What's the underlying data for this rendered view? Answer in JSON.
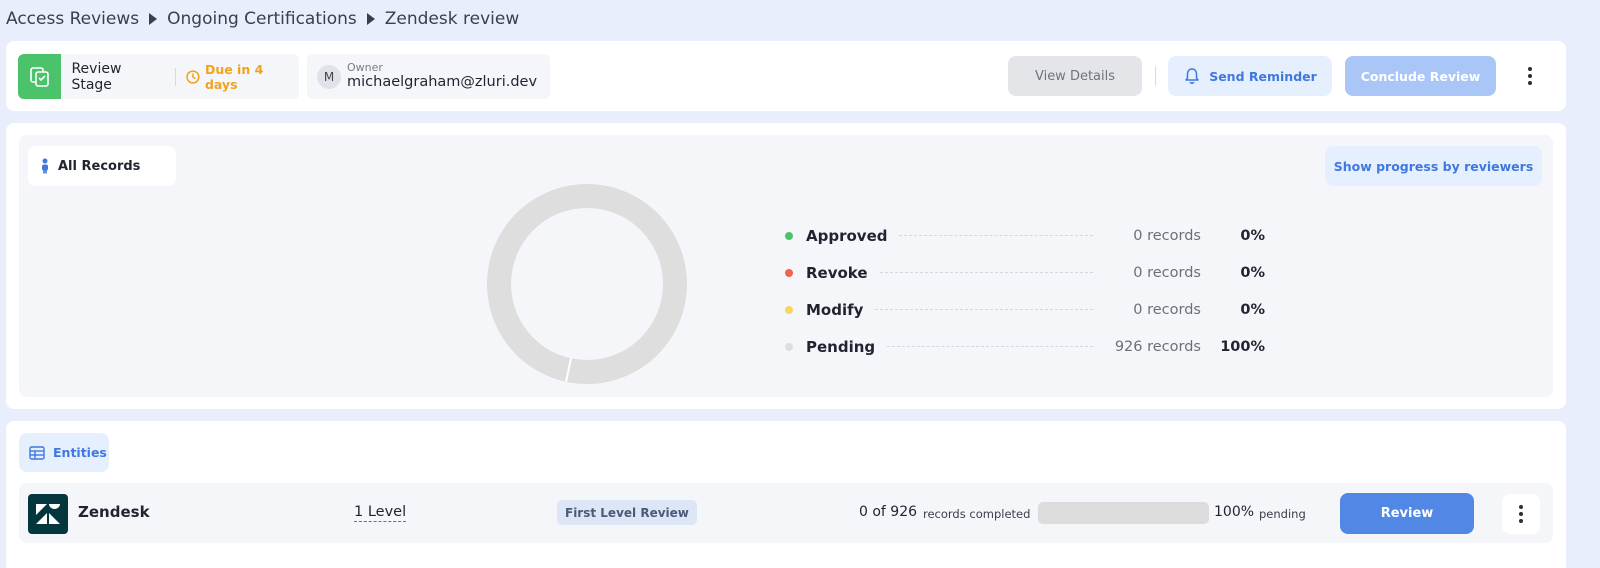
{
  "breadcrumb": [
    "Access Reviews",
    "Ongoing Certifications",
    "Zendesk review"
  ],
  "header": {
    "stage_label": "Review Stage",
    "due_label": "Due in 4 days",
    "owner_label": "Owner",
    "owner_initial": "M",
    "owner_email": "michaelgraham@zluri.dev",
    "view_details": "View Details",
    "send_reminder": "Send Reminder",
    "conclude_review": "Conclude Review"
  },
  "records": {
    "filter_label": "All Records",
    "show_progress": "Show progress by reviewers",
    "legend": [
      {
        "name": "Approved",
        "count": "0 records",
        "pct": "0%",
        "color": "#4cc26a"
      },
      {
        "name": "Revoke",
        "count": "0 records",
        "pct": "0%",
        "color": "#f0634f"
      },
      {
        "name": "Modify",
        "count": "0 records",
        "pct": "0%",
        "color": "#fbd561"
      },
      {
        "name": "Pending",
        "count": "926 records",
        "pct": "100%",
        "color": "#dedede"
      }
    ]
  },
  "chart_data": {
    "type": "pie",
    "categories": [
      "Approved",
      "Revoke",
      "Modify",
      "Pending"
    ],
    "values": [
      0,
      0,
      0,
      926
    ]
  },
  "entities": {
    "tab_label": "Entities",
    "rows": [
      {
        "name": "Zendesk",
        "level": "1 Level",
        "review_type": "First Level Review",
        "count": "0 of 926",
        "count_label": "records completed",
        "progress": 0,
        "pct_pending": "100%",
        "pending_label": "pending",
        "review_button": "Review"
      }
    ]
  },
  "colors": {
    "accent": "#3e78e0",
    "stage_green": "#4cc26a",
    "due_orange": "#f2a31b",
    "zendesk_brand": "#03363d"
  }
}
